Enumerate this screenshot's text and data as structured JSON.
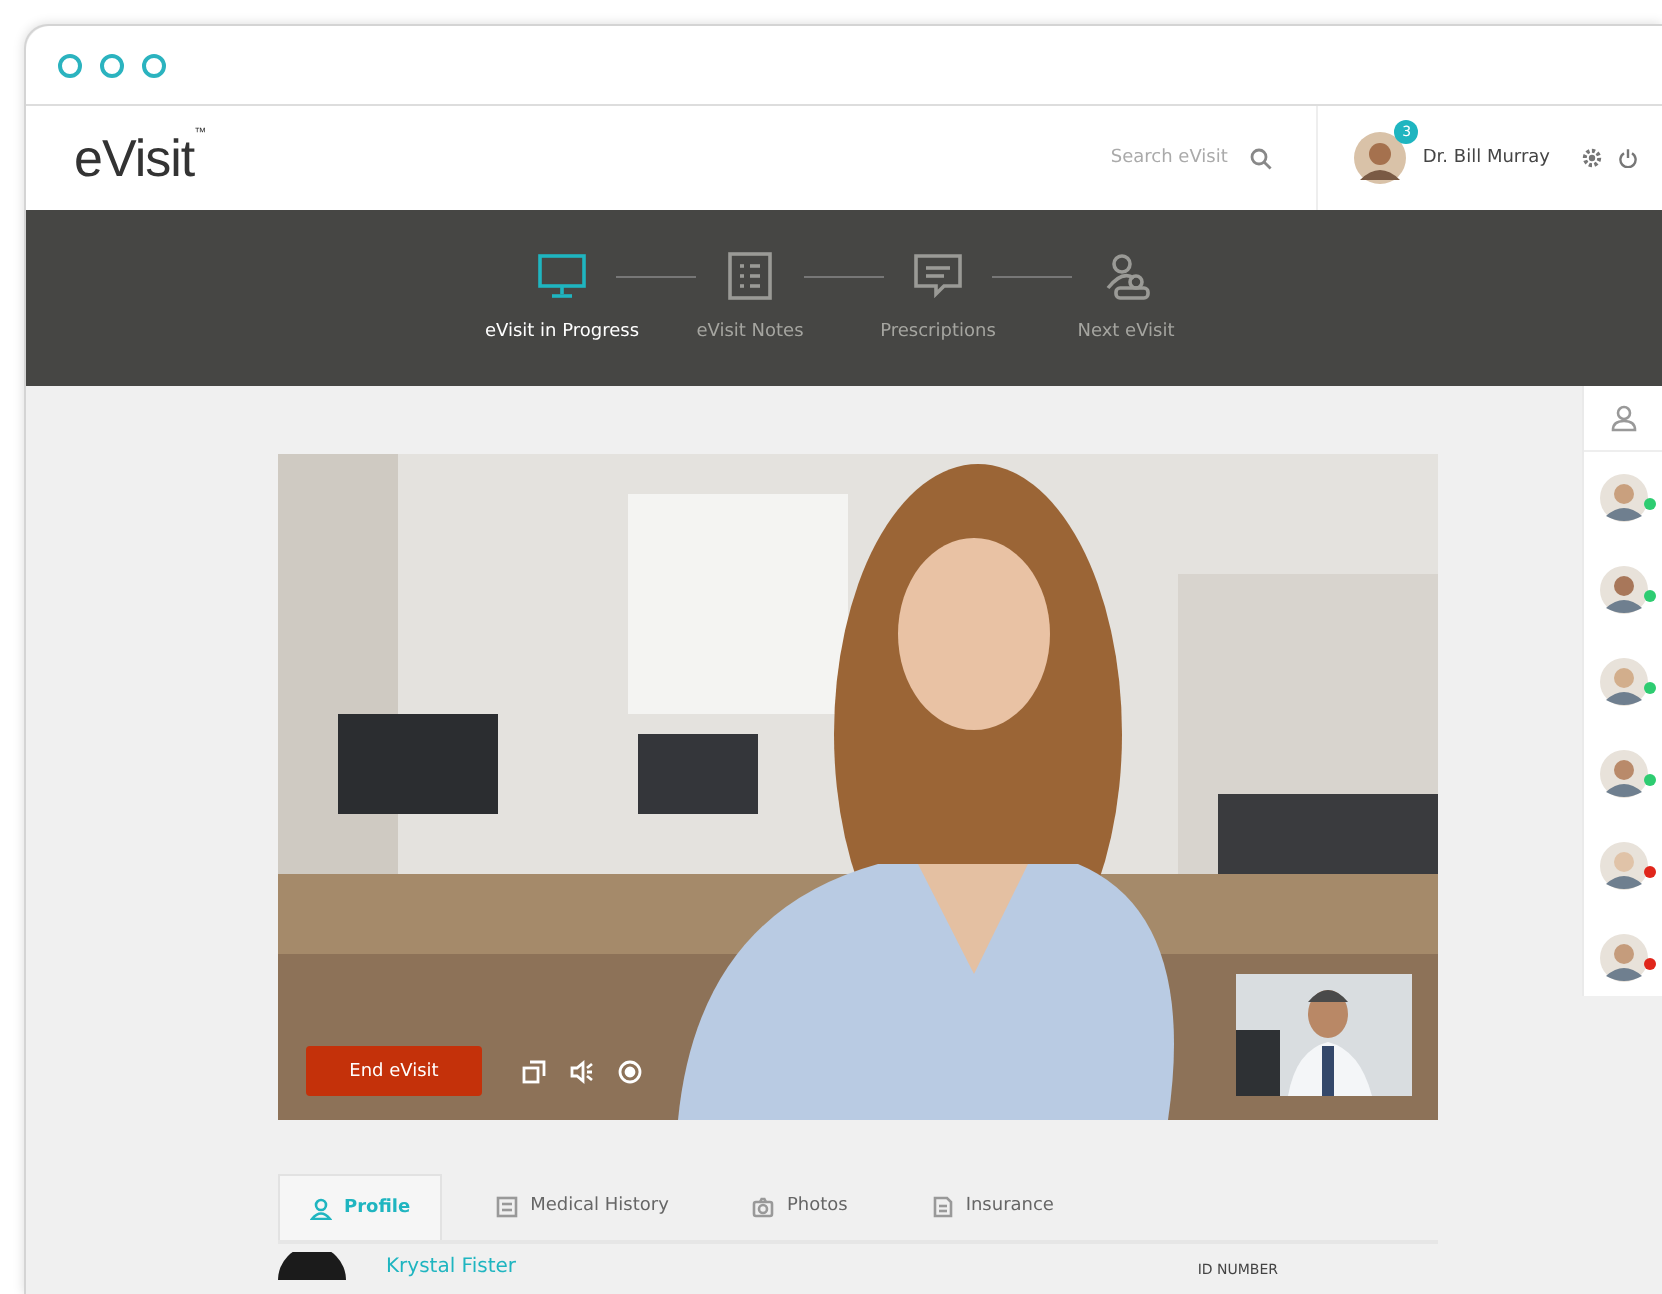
{
  "header": {
    "logo": "eVisit",
    "logo_mark": "™"
  },
  "search": {
    "placeholder": "Search eVisit"
  },
  "user": {
    "name": "Dr. Bill Murray",
    "badge": "3"
  },
  "steps": [
    {
      "label": "eVisit in Progress",
      "kind": "monitor",
      "selected": true
    },
    {
      "label": "eVisit Notes",
      "kind": "notes",
      "selected": false
    },
    {
      "label": "Prescriptions",
      "kind": "chat",
      "selected": false
    },
    {
      "label": "Next eVisit",
      "kind": "people",
      "selected": false
    }
  ],
  "video": {
    "end_button": "End eVisit"
  },
  "tabs": [
    {
      "label": "Profile",
      "kind": "person",
      "selected": true
    },
    {
      "label": "Medical History",
      "kind": "list",
      "selected": false
    },
    {
      "label": "Photos",
      "kind": "camera",
      "selected": false
    },
    {
      "label": "Insurance",
      "kind": "doc",
      "selected": false
    }
  ],
  "patient": {
    "name": "Krystal Fister",
    "id_label": "ID NUMBER"
  },
  "contacts": [
    {
      "color": "#2ecc71"
    },
    {
      "color": "#2ecc71"
    },
    {
      "color": "#2ecc71"
    },
    {
      "color": "#2ecc71"
    },
    {
      "color": "#e0261b"
    },
    {
      "color": "#e0261b"
    }
  ]
}
